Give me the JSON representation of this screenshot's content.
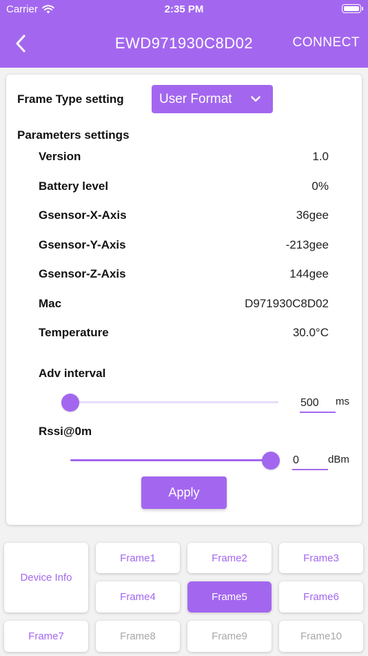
{
  "status_bar": {
    "carrier": "Carrier",
    "time": "2:35 PM"
  },
  "nav": {
    "title": "EWD971930C8D02",
    "connect_label": "CONNECT"
  },
  "frame_type": {
    "label": "Frame Type setting",
    "selected": "User Format"
  },
  "params": {
    "title": "Parameters settings",
    "rows": [
      {
        "label": "Version",
        "value": "1.0"
      },
      {
        "label": "Battery level",
        "value": "0%"
      },
      {
        "label": "Gsensor-X-Axis",
        "value": "36gee"
      },
      {
        "label": "Gsensor-Y-Axis",
        "value": "-213gee"
      },
      {
        "label": "Gsensor-Z-Axis",
        "value": "144gee"
      },
      {
        "label": "Mac",
        "value": "D971930C8D02"
      },
      {
        "label": "Temperature",
        "value": "30.0°C"
      }
    ]
  },
  "adv_interval": {
    "label": "Adv interval",
    "value": "500",
    "unit": "ms",
    "level": 0.0
  },
  "rssi": {
    "label": "Rssi@0m",
    "value": "0",
    "unit": "dBm",
    "level": 1.0
  },
  "apply_label": "Apply",
  "tabs": {
    "device_info": "Device Info",
    "frames": [
      {
        "label": "Frame1",
        "state": "normal"
      },
      {
        "label": "Frame2",
        "state": "normal"
      },
      {
        "label": "Frame3",
        "state": "normal"
      },
      {
        "label": "Frame4",
        "state": "normal"
      },
      {
        "label": "Frame5",
        "state": "active"
      },
      {
        "label": "Frame6",
        "state": "normal"
      },
      {
        "label": "Frame7",
        "state": "normal"
      },
      {
        "label": "Frame8",
        "state": "disabled"
      },
      {
        "label": "Frame9",
        "state": "disabled"
      },
      {
        "label": "Frame10",
        "state": "disabled"
      }
    ]
  },
  "colors": {
    "accent": "#a367ef",
    "accent_light": "#eadbfb",
    "disabled_text": "#a8a8a8"
  }
}
